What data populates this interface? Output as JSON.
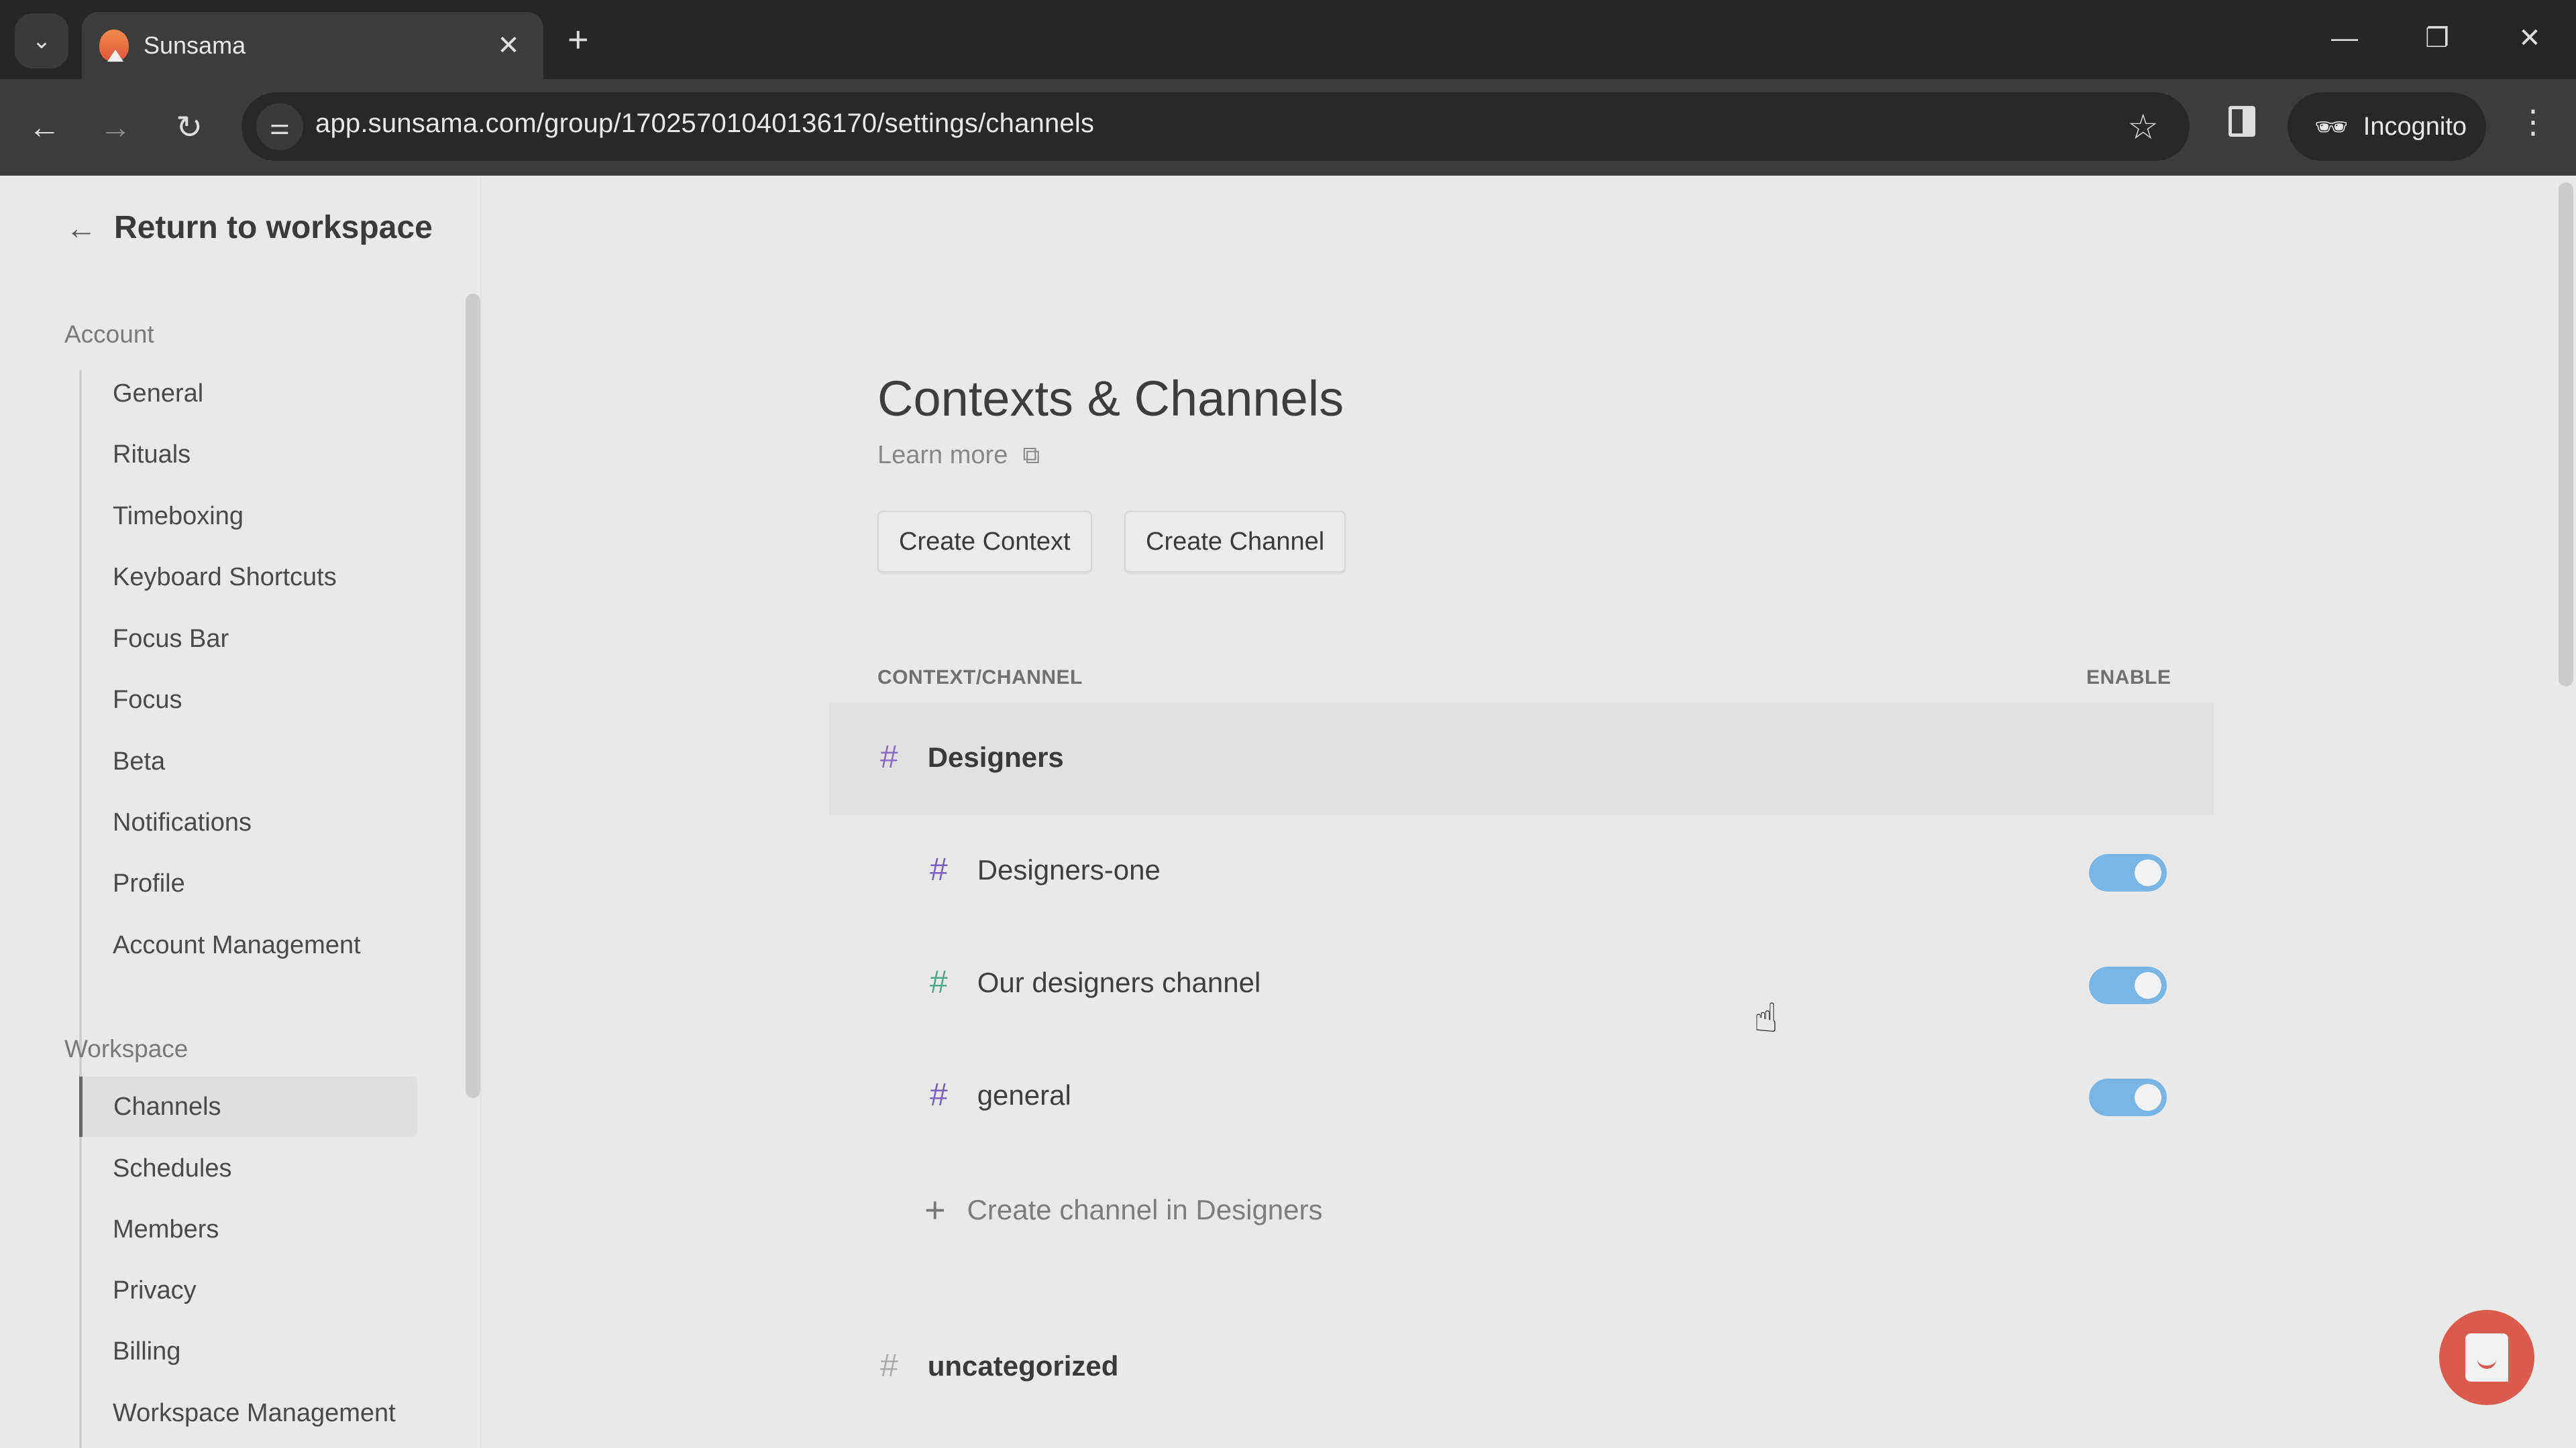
{
  "browser": {
    "tab_title": "Sunsama",
    "url": "app.sunsama.com/group/17025701040136170/settings/channels",
    "profile_label": "Incognito",
    "icons": {
      "tab_search": "chevron-down-icon",
      "favicon": "sunsama-logo-icon",
      "tab_close": "close-icon",
      "new_tab": "plus-icon",
      "minimize": "minimize-icon",
      "restore": "restore-icon",
      "close": "close-icon",
      "back": "arrow-left-icon",
      "forward": "arrow-right-icon",
      "reload": "reload-icon",
      "site_info": "tune-icon",
      "bookmark": "star-icon",
      "side_panel": "side-panel-icon",
      "incognito": "incognito-icon",
      "menu": "kebab-menu-icon"
    },
    "glyphs": {
      "tab_search": "⌄",
      "tab_close": "✕",
      "new_tab": "+",
      "minimize": "—",
      "restore": "❐",
      "close": "✕",
      "back": "←",
      "forward": "→",
      "reload": "↻",
      "site_info": "⚌",
      "bookmark": "☆",
      "incognito": "🕶",
      "menu": "⋮"
    }
  },
  "sidebar": {
    "return_label": "Return to workspace",
    "return_glyph": "←",
    "sections": [
      {
        "label": "Account",
        "items": [
          "General",
          "Rituals",
          "Timeboxing",
          "Keyboard Shortcuts",
          "Focus Bar",
          "Focus",
          "Beta",
          "Notifications",
          "Profile",
          "Account Management"
        ]
      },
      {
        "label": "Workspace",
        "items": [
          "Channels",
          "Schedules",
          "Members",
          "Privacy",
          "Billing",
          "Workspace Management"
        ],
        "active": "Channels"
      }
    ]
  },
  "main": {
    "title": "Contexts & Channels",
    "learn_more": "Learn more",
    "learn_more_glyph": "⧉",
    "buttons": {
      "create_context": "Create Context",
      "create_channel": "Create Channel"
    },
    "columns": {
      "name": "CONTEXT/CHANNEL",
      "enable": "ENABLE"
    },
    "contexts": [
      {
        "name": "Designers",
        "hash_color": "#8a6ac7",
        "channels": [
          {
            "name": "Designers-one",
            "hash_color": "#7b5fc0",
            "enabled": true
          },
          {
            "name": "Our designers channel",
            "hash_color": "#4fa58a",
            "enabled": true
          },
          {
            "name": "general",
            "hash_color": "#7b5fc0",
            "enabled": true
          }
        ],
        "create_channel_label": "Create channel in Designers"
      },
      {
        "name": "uncategorized",
        "hash_color": "#aaaaaa",
        "channels": []
      }
    ],
    "hash_glyph": "#",
    "plus_glyph": "+"
  },
  "colors": {
    "toggle_on": "#7ab6e5",
    "chat_button": "#db5a4e"
  }
}
